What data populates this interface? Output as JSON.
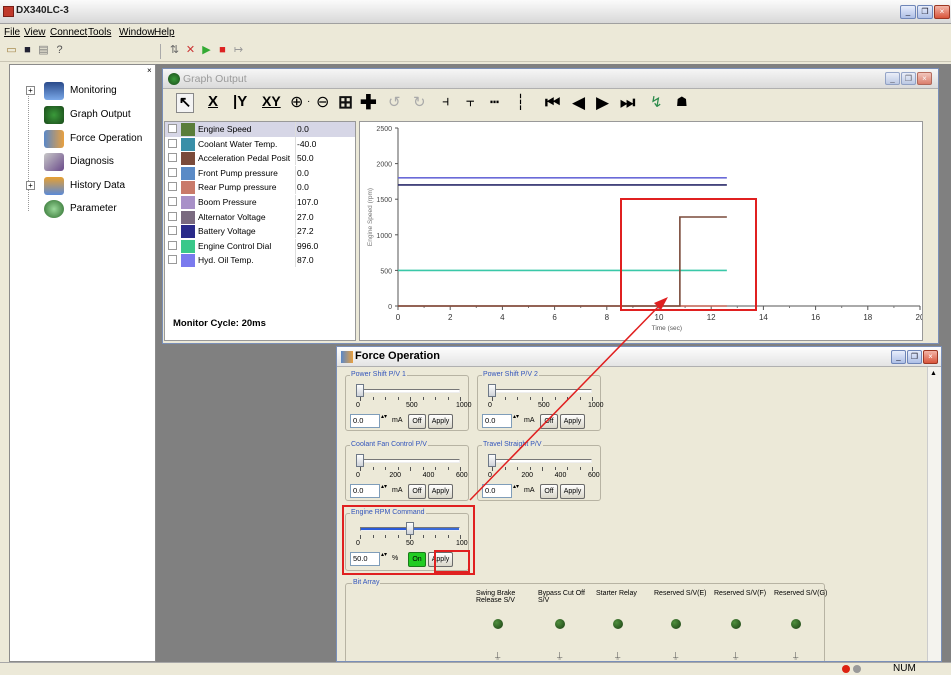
{
  "app": {
    "title": "DX340LC-3"
  },
  "menu": [
    "File",
    "View",
    "Connect",
    "Tools",
    "Window",
    "Help"
  ],
  "tree": [
    {
      "label": "Monitoring",
      "icon": "monitor-icon",
      "expander": "+"
    },
    {
      "label": "Graph Output",
      "icon": "graph-icon",
      "expander": ""
    },
    {
      "label": "Force Operation",
      "icon": "force-icon",
      "expander": ""
    },
    {
      "label": "Diagnosis",
      "icon": "diagnosis-icon",
      "expander": ""
    },
    {
      "label": "History Data",
      "icon": "history-icon",
      "expander": "+"
    },
    {
      "label": "Parameter",
      "icon": "parameter-icon",
      "expander": ""
    }
  ],
  "graph": {
    "title": "Graph Output",
    "monitor_cycle": "Monitor Cycle: 20ms",
    "signals": [
      {
        "name": "Engine Speed",
        "value": "0.0",
        "color": "#5a7d3a"
      },
      {
        "name": "Coolant Water Temp.",
        "value": "-40.0",
        "color": "#3a8fa8"
      },
      {
        "name": "Acceleration Pedal Posit",
        "value": "50.0",
        "color": "#7a4a3a"
      },
      {
        "name": "Front Pump pressure",
        "value": "0.0",
        "color": "#5a8ac6"
      },
      {
        "name": "Rear Pump pressure",
        "value": "0.0",
        "color": "#c97a6a"
      },
      {
        "name": "Boom Pressure",
        "value": "107.0",
        "color": "#a890c8"
      },
      {
        "name": "Alternator Voltage",
        "value": "27.0",
        "color": "#7a6a80"
      },
      {
        "name": "Battery Voltage",
        "value": "27.2",
        "color": "#2a2a8a"
      },
      {
        "name": "Engine Control Dial",
        "value": "996.0",
        "color": "#3ac88a"
      },
      {
        "name": "Hyd. Oil Temp.",
        "value": "87.0",
        "color": "#7a7aee"
      }
    ]
  },
  "chart_data": {
    "type": "line",
    "xlabel": "Time (sec)",
    "ylabel": "Engine Speed (rpm)",
    "xlim": [
      0,
      20
    ],
    "ylim": [
      0,
      2500
    ],
    "x_ticks": [
      "0",
      "2",
      "4",
      "6",
      "8",
      "10",
      "12",
      "14",
      "16",
      "18",
      "20"
    ],
    "y_ticks": [
      "0",
      "500",
      "1000",
      "1500",
      "2000",
      "2500"
    ],
    "series": [
      {
        "color": "#6a6ad8",
        "x": [
          0,
          12.6
        ],
        "y": [
          1800,
          1800
        ]
      },
      {
        "color": "#2a2a6a",
        "x": [
          0,
          12.6
        ],
        "y": [
          1700,
          1700
        ]
      },
      {
        "color": "#3ac8a8",
        "x": [
          0,
          12.6
        ],
        "y": [
          500,
          500
        ]
      },
      {
        "color": "#c06050",
        "x": [
          0,
          12.6
        ],
        "y": [
          0,
          0
        ]
      },
      {
        "color": "#7a4a3a",
        "x": [
          0,
          10.8,
          10.8,
          12.6
        ],
        "y": [
          0,
          0,
          1250,
          1250
        ]
      }
    ]
  },
  "force": {
    "title": "Force Operation",
    "groups": [
      {
        "label": "Power Shift P/V 1",
        "ticks": [
          "0",
          "500",
          "1000"
        ],
        "value": "0.0",
        "unit": "mA",
        "pos": 0.0
      },
      {
        "label": "Power Shift P/V 2",
        "ticks": [
          "0",
          "500",
          "1000"
        ],
        "value": "0.0",
        "unit": "mA",
        "pos": 0.0
      },
      {
        "label": "Coolant Fan Control P/V",
        "ticks": [
          "0",
          "200",
          "400",
          "600"
        ],
        "value": "0.0",
        "unit": "mA",
        "pos": 0.0
      },
      {
        "label": "Travel Straight P/V",
        "ticks": [
          "0",
          "200",
          "400",
          "600"
        ],
        "value": "0.0",
        "unit": "mA",
        "pos": 0.0
      },
      {
        "label": "Engine RPM Command",
        "ticks": [
          "0",
          "50",
          "100"
        ],
        "value": "50.0",
        "unit": "%",
        "pos": 0.5
      }
    ],
    "off_label": "Off",
    "on_label": "On",
    "apply_label": "Apply",
    "bit_array": {
      "label": "Bit Array",
      "items": [
        "Swing Brake Release S/V",
        "Bypass Cut Off S/V",
        "Starter Relay",
        "Reserved S/V(E)",
        "Reserved S/V(F)",
        "Reserved S/V(G)"
      ]
    }
  },
  "status": {
    "num": "NUM"
  }
}
